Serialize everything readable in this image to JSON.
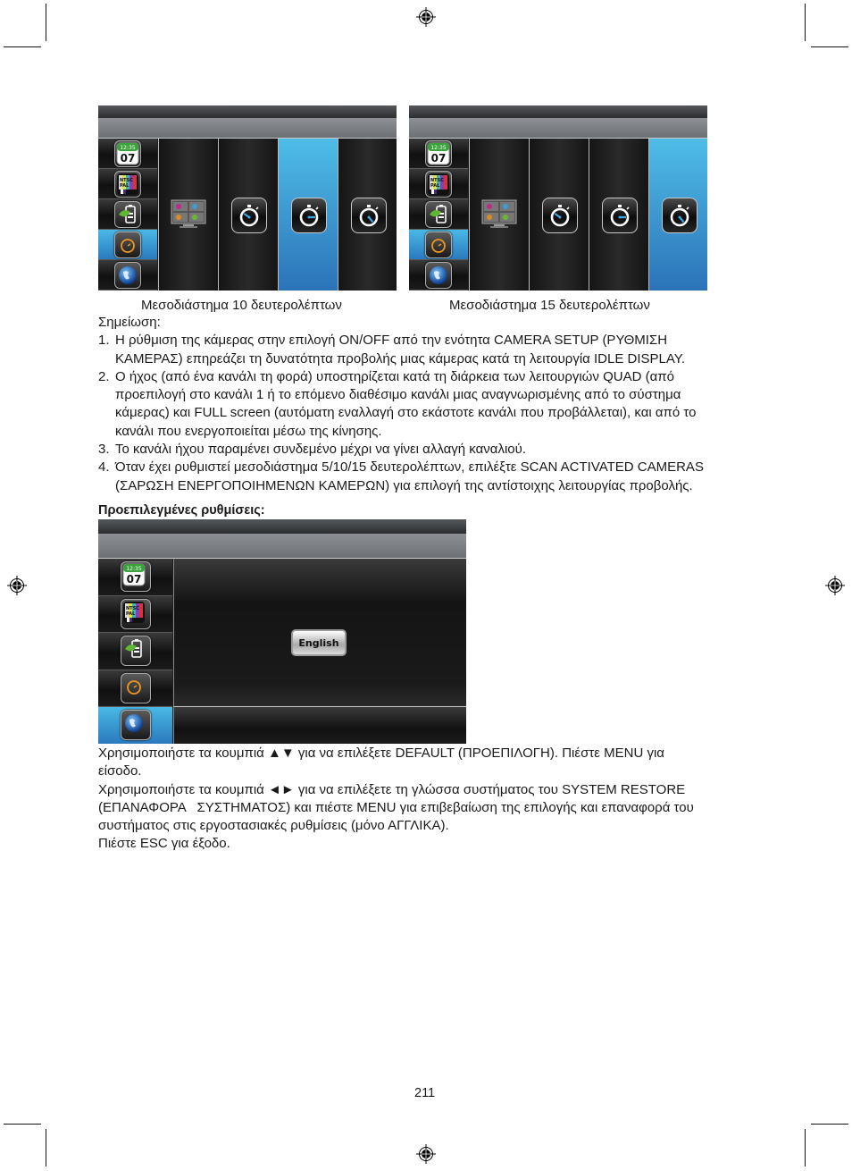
{
  "page_number": "211",
  "screens": {
    "sidebar_icons": [
      "calendar-clock-icon",
      "ntsc-pal-icon",
      "eco-battery-icon",
      "timer-icon",
      "globe-icon"
    ],
    "calendar_time": "12:35",
    "calendar_day": "07",
    "ntsc_label": "NTSC",
    "pal_label": "PAL",
    "screen1": {
      "caption": "Μεσοδιάστημα 10 δευτερολέπτων",
      "selected_option": 3
    },
    "screen2": {
      "caption": "Μεσοδιάστημα 15 δευτερολέπτων",
      "selected_option": 4
    },
    "screen3": {
      "language_button": "English"
    }
  },
  "accent_color": "#3a9bd6",
  "note": {
    "title": "Σημείωση:",
    "items": [
      {
        "num": "1.",
        "lines": [
          "Η ρύθμιση της κάμερας στην επιλογή ON/OFF από την ενότητα CAMERA SETUP (ΡΥΘΜΙΣΗ",
          "ΚΑΜΕΡΑΣ) επηρεάζει τη δυνατότητα προβολής μιας κάμερας κατά τη λειτουργία IDLE DISPLAY."
        ]
      },
      {
        "num": "2.",
        "lines": [
          "Ο ήχος (από ένα κανάλι τη φορά) υποστηρίζεται κατά τη διάρκεια των λειτουργιών QUAD (από",
          "προεπιλογή στο κανάλι 1 ή το επόμενο διαθέσιμο κανάλι μιας αναγνωρισμένης από το σύστημα",
          "κάμερας) και FULL screen (αυτόματη εναλλαγή στο εκάστοτε κανάλι που προβάλλεται), και από το",
          "κανάλι που ενεργοποιείται μέσω της κίνησης."
        ]
      },
      {
        "num": "3.",
        "lines": [
          "Το κανάλι ήχου παραμένει συνδεμένο μέχρι να γίνει αλλαγή καναλιού."
        ]
      },
      {
        "num": "4.",
        "lines": [
          "Όταν έχει ρυθμιστεί μεσοδιάστημα 5/10/15 δευτερολέπτων, επιλέξτε SCAN ACTIVATED CAMERAS",
          "(ΣΑΡΩΣΗ ΕΝΕΡΓΟΠΟΙΗΜΕΝΩΝ ΚΑΜΕΡΩΝ) για επιλογή της αντίστοιχης λειτουργίας προβολής."
        ]
      }
    ]
  },
  "defaults_heading": "Προεπιλεγμένες ρυθμίσεις:",
  "instructions": [
    "Χρησιμοποιήστε τα κουμπιά ▲▼ για να επιλέξετε DEFAULT (ΠΡΟΕΠΙΛΟΓΗ). Πιέστε MENU για",
    "είσοδο.",
    "Χρησιμοποιήστε τα κουμπιά ◄► για να επιλέξετε τη γλώσσα συστήματος του SYSTEM RESTORE",
    "(ΕΠΑΝΑΦΟΡΑ   ΣΥΣΤΗΜΑΤΟΣ) και πιέστε MENU για επιβεβαίωση της επιλογής και επαναφορά του",
    "συστήματος στις εργοστασιακές ρυθμίσεις (μόνο ΑΓΓΛΙΚΑ).",
    "Πιέστε ESC για έξοδο."
  ]
}
